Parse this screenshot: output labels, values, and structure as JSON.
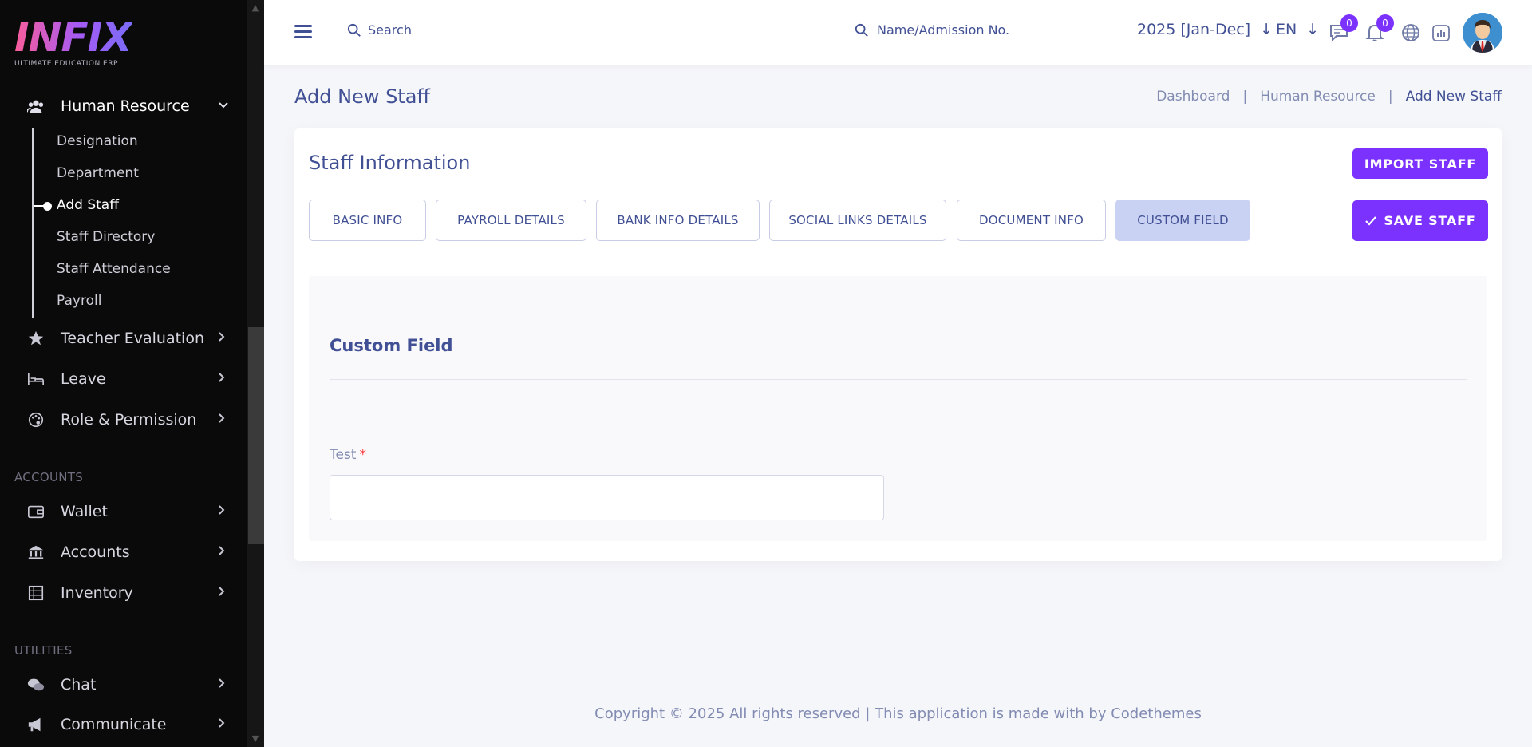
{
  "sidebar": {
    "logo_text": "INFIX",
    "logo_subtitle": "ULTIMATE EDUCATION ERP",
    "human_resource": {
      "label": "Human Resource",
      "icon": "users-icon",
      "children": [
        "Designation",
        "Department",
        "Add Staff",
        "Staff Directory",
        "Staff Attendance",
        "Payroll"
      ],
      "active_child": "Add Staff"
    },
    "items": [
      {
        "label": "Teacher Evaluation",
        "icon": "star-icon"
      },
      {
        "label": "Leave",
        "icon": "bed-icon"
      },
      {
        "label": "Role & Permission",
        "icon": "palette-icon"
      }
    ],
    "accounts_section": "ACCOUNTS",
    "accounts_items": [
      {
        "label": "Wallet",
        "icon": "wallet-icon"
      },
      {
        "label": "Accounts",
        "icon": "bank-icon"
      },
      {
        "label": "Inventory",
        "icon": "inventory-icon"
      }
    ],
    "utilities_section": "UTILITIES",
    "utilities_items": [
      {
        "label": "Chat",
        "icon": "chat-icon"
      },
      {
        "label": "Communicate",
        "icon": "megaphone-icon"
      }
    ]
  },
  "header": {
    "search_placeholder": "Search",
    "admission_placeholder": "Name/Admission No.",
    "academic_year": "2025 [Jan-Dec]",
    "language": "EN",
    "messages_count": "0",
    "notifications_count": "0"
  },
  "page": {
    "title": "Add New Staff",
    "breadcrumb": [
      "Dashboard",
      "Human Resource",
      "Add New Staff"
    ]
  },
  "card": {
    "title": "Staff Information",
    "import_button": "IMPORT STAFF",
    "save_button": "SAVE STAFF",
    "tabs": [
      "BASIC INFO",
      "PAYROLL DETAILS",
      "BANK INFO DETAILS",
      "SOCIAL LINKS DETAILS",
      "DOCUMENT INFO",
      "CUSTOM FIELD"
    ],
    "active_tab": "CUSTOM FIELD"
  },
  "custom_field": {
    "title": "Custom Field",
    "field_label": "Test",
    "required_mark": "*",
    "field_value": ""
  },
  "footer": {
    "text": "Copyright © 2025 All rights reserved | This application is made with by Codethemes"
  },
  "colors": {
    "primary": "#7c32ff",
    "text": "#415094",
    "muted": "#828bb2",
    "sidebar_bg": "#0a0a0a",
    "active_tab": "#c9d2f2"
  }
}
